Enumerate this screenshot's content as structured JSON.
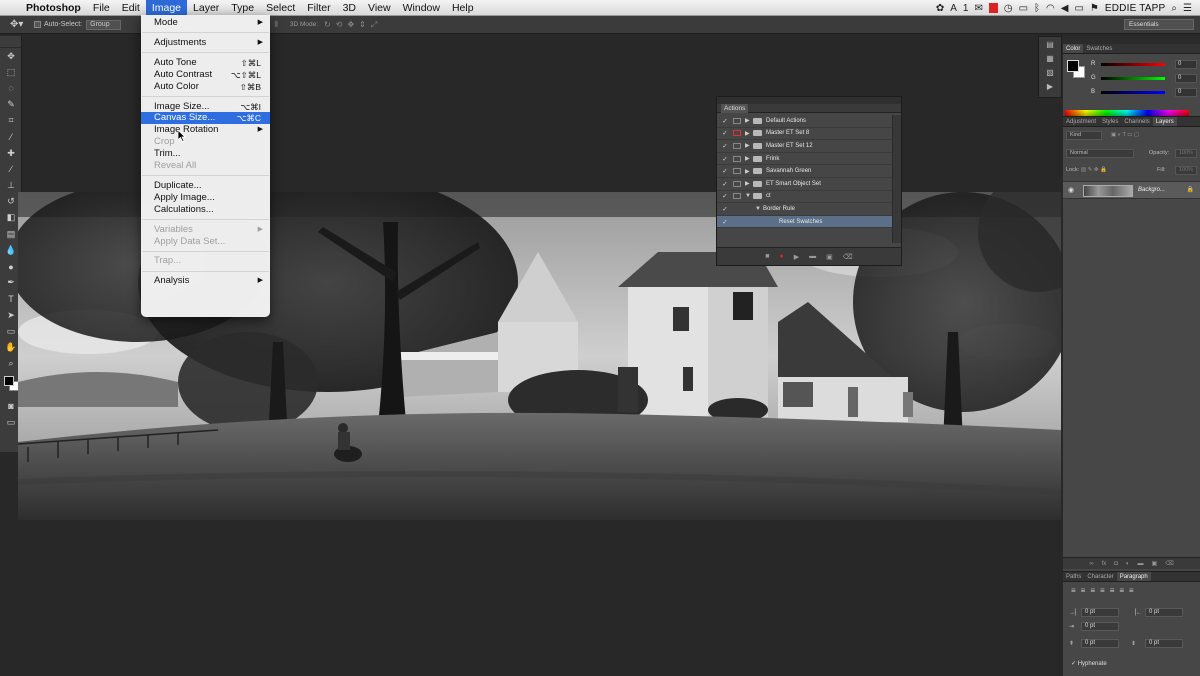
{
  "menubar": {
    "app_name": "Photoshop",
    "items": [
      "File",
      "Edit",
      "Image",
      "Layer",
      "Type",
      "Select",
      "Filter",
      "3D",
      "View",
      "Window",
      "Help"
    ],
    "active_item": "Image",
    "status_icons": [
      "creative-cloud-icon",
      "adobe-updates-icon",
      "recording-icon",
      "mail-icon",
      "time-machine-icon",
      "display-icon",
      "wifi-icon",
      "volume-icon",
      "battery-icon",
      "flag-icon"
    ],
    "status_badge": "1",
    "user_name": "EDDIE TAPP"
  },
  "options_bar": {
    "auto_select_label": "Auto-Select:",
    "auto_select_value": "Group",
    "mode_3d_label": "3D Mode:",
    "workspace": "Essentials"
  },
  "image_menu": {
    "items": [
      {
        "label": "Mode",
        "shortcut": "",
        "submenu": true,
        "disabled": false,
        "highlight": false
      },
      {
        "sep": true
      },
      {
        "label": "Adjustments",
        "shortcut": "",
        "submenu": true,
        "disabled": false,
        "highlight": false
      },
      {
        "sep": true
      },
      {
        "label": "Auto Tone",
        "shortcut": "⇧⌘L",
        "submenu": false,
        "disabled": false,
        "highlight": false
      },
      {
        "label": "Auto Contrast",
        "shortcut": "⌥⇧⌘L",
        "submenu": false,
        "disabled": false,
        "highlight": false
      },
      {
        "label": "Auto Color",
        "shortcut": "⇧⌘B",
        "submenu": false,
        "disabled": false,
        "highlight": false
      },
      {
        "sep": true
      },
      {
        "label": "Image Size...",
        "shortcut": "⌥⌘I",
        "submenu": false,
        "disabled": false,
        "highlight": false
      },
      {
        "label": "Canvas Size...",
        "shortcut": "⌥⌘C",
        "submenu": false,
        "disabled": false,
        "highlight": true
      },
      {
        "label": "Image Rotation",
        "shortcut": "",
        "submenu": true,
        "disabled": false,
        "highlight": false
      },
      {
        "label": "Crop",
        "shortcut": "",
        "submenu": false,
        "disabled": true,
        "highlight": false
      },
      {
        "label": "Trim...",
        "shortcut": "",
        "submenu": false,
        "disabled": false,
        "highlight": false
      },
      {
        "label": "Reveal All",
        "shortcut": "",
        "submenu": false,
        "disabled": true,
        "highlight": false
      },
      {
        "sep": true
      },
      {
        "label": "Duplicate...",
        "shortcut": "",
        "submenu": false,
        "disabled": false,
        "highlight": false
      },
      {
        "label": "Apply Image...",
        "shortcut": "",
        "submenu": false,
        "disabled": false,
        "highlight": false
      },
      {
        "label": "Calculations...",
        "shortcut": "",
        "submenu": false,
        "disabled": false,
        "highlight": false
      },
      {
        "sep": true
      },
      {
        "label": "Variables",
        "shortcut": "",
        "submenu": true,
        "disabled": true,
        "highlight": false
      },
      {
        "label": "Apply Data Set...",
        "shortcut": "",
        "submenu": false,
        "disabled": true,
        "highlight": false
      },
      {
        "sep": true
      },
      {
        "label": "Trap...",
        "shortcut": "",
        "submenu": false,
        "disabled": true,
        "highlight": false
      },
      {
        "sep": true
      },
      {
        "label": "Analysis",
        "shortcut": "",
        "submenu": true,
        "disabled": false,
        "highlight": false
      }
    ]
  },
  "actions_panel": {
    "tab": "Actions",
    "rows": [
      {
        "label": "Default Actions",
        "level": 0,
        "checked": true,
        "dialog_red": false,
        "expanded": false,
        "type": "set"
      },
      {
        "label": "Master ET Set 8",
        "level": 0,
        "checked": true,
        "dialog_red": true,
        "expanded": false,
        "type": "set"
      },
      {
        "label": "Master ET Set 12",
        "level": 0,
        "checked": true,
        "dialog_red": false,
        "expanded": false,
        "type": "set"
      },
      {
        "label": "Frink",
        "level": 0,
        "checked": true,
        "dialog_red": false,
        "expanded": false,
        "type": "set"
      },
      {
        "label": "Savannah Green",
        "level": 0,
        "checked": true,
        "dialog_red": false,
        "expanded": false,
        "type": "set"
      },
      {
        "label": "ET Smart Object Set",
        "level": 0,
        "checked": true,
        "dialog_red": false,
        "expanded": false,
        "type": "set"
      },
      {
        "label": "ct",
        "level": 0,
        "checked": true,
        "dialog_red": false,
        "expanded": true,
        "type": "set"
      },
      {
        "label": "Border Rule",
        "level": 1,
        "checked": true,
        "dialog_red": false,
        "expanded": true,
        "type": "action"
      },
      {
        "label": "Reset Swatches",
        "level": 2,
        "checked": true,
        "dialog_red": false,
        "expanded": false,
        "type": "step",
        "selected": true
      }
    ]
  },
  "color_panel": {
    "tabs": [
      "Color",
      "Swatches"
    ],
    "active_tab": "Color",
    "r_label": "R",
    "g_label": "G",
    "b_label": "B",
    "r": "0",
    "g": "0",
    "b": "0"
  },
  "layers_panel": {
    "tabs": [
      "Adjustment",
      "Styles",
      "Channels",
      "Layers"
    ],
    "active_tab": "Layers",
    "kind_label": "Kind",
    "blend_mode": "Normal",
    "opacity_label": "Opacity:",
    "opacity": "100%",
    "lock_label": "Lock:",
    "fill_label": "Fill:",
    "fill": "100%",
    "layer_name": "Backgro..."
  },
  "paragraph_panel": {
    "tabs": [
      "Paths",
      "Character",
      "Paragraph"
    ],
    "active_tab": "Paragraph",
    "indent_left": "0 pt",
    "indent_right": "0 pt",
    "indent_first": "0 pt",
    "space_before": "0 pt",
    "space_after": "0 pt",
    "hyphenate_label": "Hyphenate"
  },
  "colors": {
    "menu_highlight": "#2e6ee0",
    "panel_bg": "#474747",
    "app_bg": "#282828"
  }
}
